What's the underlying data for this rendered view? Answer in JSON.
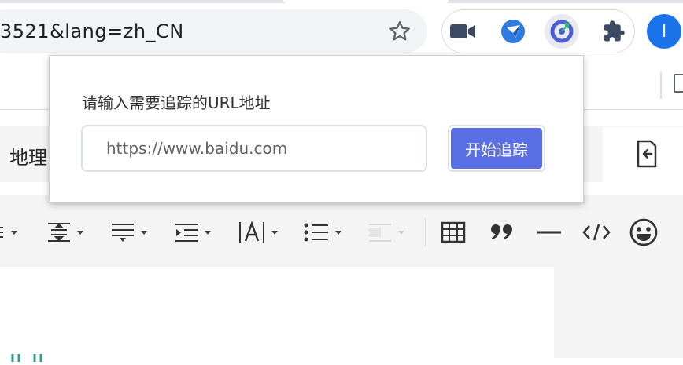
{
  "browser": {
    "address_bar_text": "3521&lang=zh_CN",
    "avatar_initial": "I",
    "icons": {
      "star": "star-icon",
      "extensions": [
        "video-camera-icon",
        "navigation-arrow-icon",
        "tracker-extension-icon",
        "puzzle-piece-icon"
      ]
    }
  },
  "page": {
    "title_fragment": "地理",
    "toolbar_items": [
      "align-icon",
      "line-height-icon",
      "paragraph-spacing-icon",
      "indent-icon",
      "font-style-icon",
      "bullet-list-icon",
      "shading-icon",
      "table-icon",
      "quote-icon",
      "horizontal-rule-icon",
      "code-icon",
      "emoji-icon"
    ]
  },
  "popup": {
    "label": "请输入需要追踪的URL地址",
    "url_value": "https://www.baidu.com",
    "start_button_label": "开始追踪"
  },
  "colors": {
    "popup_button": "#5a6ee6",
    "avatar": "#1a73e8",
    "tracker_icon": "#4a5fd6"
  }
}
